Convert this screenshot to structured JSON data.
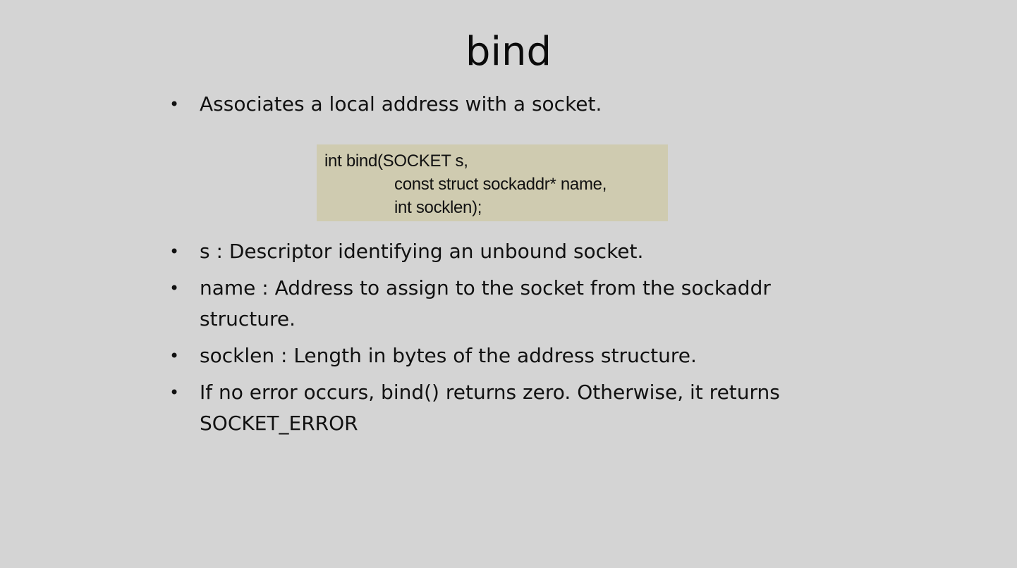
{
  "slide": {
    "title": "bind",
    "intro_bullets": [
      "Associates a local address with a socket."
    ],
    "code": {
      "lines": [
        "int bind(SOCKET s,",
        "const struct sockaddr* name,",
        "int socklen);"
      ],
      "background": "#cfcbb0"
    },
    "detail_bullets": [
      "s : Descriptor identifying an unbound socket.",
      "name : Address to assign to the socket from the sockaddr structure.",
      "socklen : Length in bytes of the address structure.",
      "If no error occurs, bind() returns zero. Otherwise, it returns SOCKET_ERROR"
    ],
    "bullet_symbol": "•",
    "background": "#d4d4d4"
  }
}
